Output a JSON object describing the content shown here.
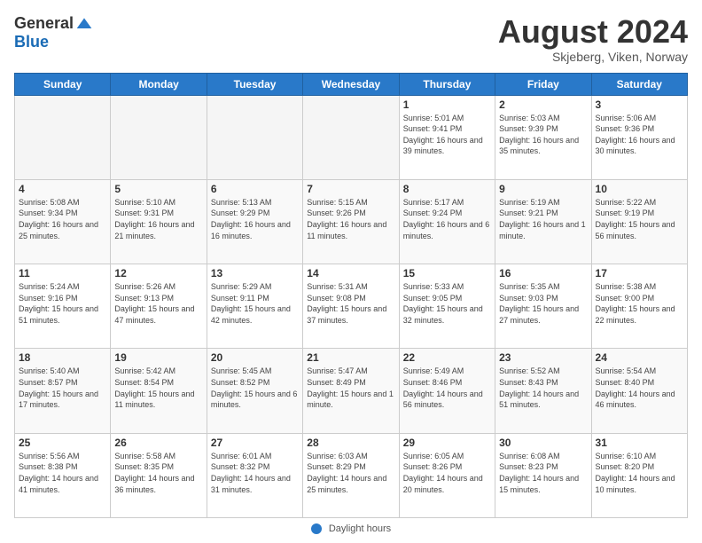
{
  "header": {
    "logo_general": "General",
    "logo_blue": "Blue",
    "month_year": "August 2024",
    "location": "Skjeberg, Viken, Norway"
  },
  "days_of_week": [
    "Sunday",
    "Monday",
    "Tuesday",
    "Wednesday",
    "Thursday",
    "Friday",
    "Saturday"
  ],
  "footer": {
    "label": "Daylight hours"
  },
  "weeks": [
    [
      {
        "day": "",
        "empty": true
      },
      {
        "day": "",
        "empty": true
      },
      {
        "day": "",
        "empty": true
      },
      {
        "day": "",
        "empty": true
      },
      {
        "day": "1",
        "sunrise": "Sunrise: 5:01 AM",
        "sunset": "Sunset: 9:41 PM",
        "daylight": "Daylight: 16 hours and 39 minutes."
      },
      {
        "day": "2",
        "sunrise": "Sunrise: 5:03 AM",
        "sunset": "Sunset: 9:39 PM",
        "daylight": "Daylight: 16 hours and 35 minutes."
      },
      {
        "day": "3",
        "sunrise": "Sunrise: 5:06 AM",
        "sunset": "Sunset: 9:36 PM",
        "daylight": "Daylight: 16 hours and 30 minutes."
      }
    ],
    [
      {
        "day": "4",
        "sunrise": "Sunrise: 5:08 AM",
        "sunset": "Sunset: 9:34 PM",
        "daylight": "Daylight: 16 hours and 25 minutes."
      },
      {
        "day": "5",
        "sunrise": "Sunrise: 5:10 AM",
        "sunset": "Sunset: 9:31 PM",
        "daylight": "Daylight: 16 hours and 21 minutes."
      },
      {
        "day": "6",
        "sunrise": "Sunrise: 5:13 AM",
        "sunset": "Sunset: 9:29 PM",
        "daylight": "Daylight: 16 hours and 16 minutes."
      },
      {
        "day": "7",
        "sunrise": "Sunrise: 5:15 AM",
        "sunset": "Sunset: 9:26 PM",
        "daylight": "Daylight: 16 hours and 11 minutes."
      },
      {
        "day": "8",
        "sunrise": "Sunrise: 5:17 AM",
        "sunset": "Sunset: 9:24 PM",
        "daylight": "Daylight: 16 hours and 6 minutes."
      },
      {
        "day": "9",
        "sunrise": "Sunrise: 5:19 AM",
        "sunset": "Sunset: 9:21 PM",
        "daylight": "Daylight: 16 hours and 1 minute."
      },
      {
        "day": "10",
        "sunrise": "Sunrise: 5:22 AM",
        "sunset": "Sunset: 9:19 PM",
        "daylight": "Daylight: 15 hours and 56 minutes."
      }
    ],
    [
      {
        "day": "11",
        "sunrise": "Sunrise: 5:24 AM",
        "sunset": "Sunset: 9:16 PM",
        "daylight": "Daylight: 15 hours and 51 minutes."
      },
      {
        "day": "12",
        "sunrise": "Sunrise: 5:26 AM",
        "sunset": "Sunset: 9:13 PM",
        "daylight": "Daylight: 15 hours and 47 minutes."
      },
      {
        "day": "13",
        "sunrise": "Sunrise: 5:29 AM",
        "sunset": "Sunset: 9:11 PM",
        "daylight": "Daylight: 15 hours and 42 minutes."
      },
      {
        "day": "14",
        "sunrise": "Sunrise: 5:31 AM",
        "sunset": "Sunset: 9:08 PM",
        "daylight": "Daylight: 15 hours and 37 minutes."
      },
      {
        "day": "15",
        "sunrise": "Sunrise: 5:33 AM",
        "sunset": "Sunset: 9:05 PM",
        "daylight": "Daylight: 15 hours and 32 minutes."
      },
      {
        "day": "16",
        "sunrise": "Sunrise: 5:35 AM",
        "sunset": "Sunset: 9:03 PM",
        "daylight": "Daylight: 15 hours and 27 minutes."
      },
      {
        "day": "17",
        "sunrise": "Sunrise: 5:38 AM",
        "sunset": "Sunset: 9:00 PM",
        "daylight": "Daylight: 15 hours and 22 minutes."
      }
    ],
    [
      {
        "day": "18",
        "sunrise": "Sunrise: 5:40 AM",
        "sunset": "Sunset: 8:57 PM",
        "daylight": "Daylight: 15 hours and 17 minutes."
      },
      {
        "day": "19",
        "sunrise": "Sunrise: 5:42 AM",
        "sunset": "Sunset: 8:54 PM",
        "daylight": "Daylight: 15 hours and 11 minutes."
      },
      {
        "day": "20",
        "sunrise": "Sunrise: 5:45 AM",
        "sunset": "Sunset: 8:52 PM",
        "daylight": "Daylight: 15 hours and 6 minutes."
      },
      {
        "day": "21",
        "sunrise": "Sunrise: 5:47 AM",
        "sunset": "Sunset: 8:49 PM",
        "daylight": "Daylight: 15 hours and 1 minute."
      },
      {
        "day": "22",
        "sunrise": "Sunrise: 5:49 AM",
        "sunset": "Sunset: 8:46 PM",
        "daylight": "Daylight: 14 hours and 56 minutes."
      },
      {
        "day": "23",
        "sunrise": "Sunrise: 5:52 AM",
        "sunset": "Sunset: 8:43 PM",
        "daylight": "Daylight: 14 hours and 51 minutes."
      },
      {
        "day": "24",
        "sunrise": "Sunrise: 5:54 AM",
        "sunset": "Sunset: 8:40 PM",
        "daylight": "Daylight: 14 hours and 46 minutes."
      }
    ],
    [
      {
        "day": "25",
        "sunrise": "Sunrise: 5:56 AM",
        "sunset": "Sunset: 8:38 PM",
        "daylight": "Daylight: 14 hours and 41 minutes."
      },
      {
        "day": "26",
        "sunrise": "Sunrise: 5:58 AM",
        "sunset": "Sunset: 8:35 PM",
        "daylight": "Daylight: 14 hours and 36 minutes."
      },
      {
        "day": "27",
        "sunrise": "Sunrise: 6:01 AM",
        "sunset": "Sunset: 8:32 PM",
        "daylight": "Daylight: 14 hours and 31 minutes."
      },
      {
        "day": "28",
        "sunrise": "Sunrise: 6:03 AM",
        "sunset": "Sunset: 8:29 PM",
        "daylight": "Daylight: 14 hours and 25 minutes."
      },
      {
        "day": "29",
        "sunrise": "Sunrise: 6:05 AM",
        "sunset": "Sunset: 8:26 PM",
        "daylight": "Daylight: 14 hours and 20 minutes."
      },
      {
        "day": "30",
        "sunrise": "Sunrise: 6:08 AM",
        "sunset": "Sunset: 8:23 PM",
        "daylight": "Daylight: 14 hours and 15 minutes."
      },
      {
        "day": "31",
        "sunrise": "Sunrise: 6:10 AM",
        "sunset": "Sunset: 8:20 PM",
        "daylight": "Daylight: 14 hours and 10 minutes."
      }
    ]
  ]
}
